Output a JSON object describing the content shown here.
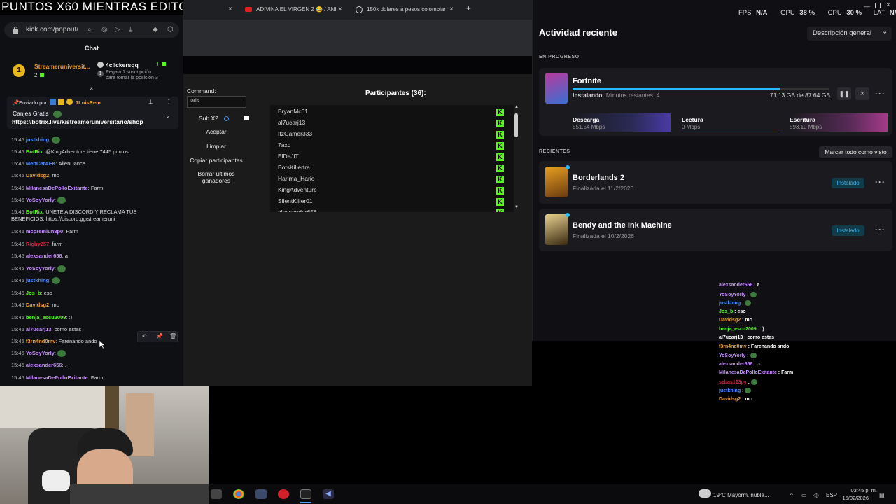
{
  "overlay_title": "PUNTOS X60 MIENTRAS EDITO",
  "chat_window": {
    "url": "kick.com/popout/",
    "header": "Chat",
    "leader_1": {
      "name": "Streameruniversit...",
      "count": "2"
    },
    "leader_2": {
      "name": "4clickersqq",
      "count": "1",
      "rank_badge": "1",
      "subtitle_line1": "Regala 1 suscripción",
      "subtitle_line2": "para tomar la posición 3"
    },
    "pinned": {
      "sent_by_label": "Enviado por",
      "sent_by_name": "1LuisRem",
      "title": "Canjes Gratis",
      "link": "https://botrix.live/k/streameruniversitario/shop"
    },
    "messages": [
      {
        "time": "15:45",
        "user": "justkhing",
        "text": "",
        "color": "#4f8cff",
        "emote": true
      },
      {
        "time": "15:45",
        "user": "BotRix",
        "text": "@KingAdventure tiene 7445 puntos.",
        "color": "#53fc18",
        "emote": false
      },
      {
        "time": "15:45",
        "user": "MenCerAFK",
        "text": "AlienDance",
        "color": "#4f8cff",
        "emote": false
      },
      {
        "time": "15:45",
        "user": "Davidsg2",
        "text": "mc",
        "color": "#f0a030",
        "emote": false
      },
      {
        "time": "15:45",
        "user": "MilanesaDePolloExitante",
        "text": "Farm",
        "color": "#c68dff",
        "emote": false
      },
      {
        "time": "15:45",
        "user": "YoSoyYorly",
        "text": "",
        "color": "#c68dff",
        "emote": true
      },
      {
        "time": "15:45",
        "user": "BotRix",
        "text": "UNETE A DISCORD Y RECLAMA TUS",
        "color": "#53fc18",
        "emote": false
      },
      {
        "time": "",
        "user": "",
        "text": "BENEFICIOS: https://discord.gg/streameruni",
        "color": "#ddd",
        "emote": false
      },
      {
        "time": "15:45",
        "user": "mcpremiun8p0",
        "text": "Farm",
        "color": "#c68dff",
        "emote": false
      },
      {
        "time": "15:45",
        "user": "Rigby257",
        "text": "farm",
        "color": "#e02040",
        "emote": false
      },
      {
        "time": "15:45",
        "user": "alexsander656",
        "text": "a",
        "color": "#c68dff",
        "emote": false
      },
      {
        "time": "15:45",
        "user": "YoSoyYorly",
        "text": "",
        "color": "#c68dff",
        "emote": true
      },
      {
        "time": "15:45",
        "user": "justkhing",
        "text": "",
        "color": "#4f8cff",
        "emote": true
      },
      {
        "time": "15:45",
        "user": "Jos_b",
        "text": "eso",
        "color": "#53fc18",
        "emote": false
      },
      {
        "time": "15:45",
        "user": "Davidsg2",
        "text": "mc",
        "color": "#f0a030",
        "emote": false
      },
      {
        "time": "15:45",
        "user": "benja_escu2009",
        "text": ":)",
        "color": "#53fc18",
        "emote": false
      },
      {
        "time": "15:45",
        "user": "al7ucarj13",
        "text": "como estas",
        "color": "#c68dff",
        "emote": false
      },
      {
        "time": "15:45",
        "user": "f3rn4nd0mv",
        "text": "Farenando ando",
        "color": "#f0a030",
        "emote": false
      },
      {
        "time": "15:45",
        "user": "YoSoyYorly",
        "text": "",
        "color": "#c68dff",
        "emote": true
      },
      {
        "time": "15:45",
        "user": "alexsander656",
        "text": ".-.",
        "color": "#c68dff",
        "emote": false
      },
      {
        "time": "15:45",
        "user": "MilanesaDePolloExitante",
        "text": "Farm",
        "color": "#c68dff",
        "emote": false
      }
    ]
  },
  "browser": {
    "tabs": [
      {
        "label": "ADIVINA EL VIRGEN 2 😂 / ANI"
      },
      {
        "label": "150k dolares a pesos colombiar"
      }
    ],
    "new_tab": "+",
    "close": "×"
  },
  "giveaway": {
    "command_label": "Command:",
    "command_value": "!aris",
    "sub_label": "Sub X2",
    "buttons": [
      "Aceptar",
      "Limpiar",
      "Copiar participantes",
      "Borrar ultimos ganadores"
    ],
    "participants_title": "Participantes (36):",
    "participants": [
      "BryanMc61",
      "al7ucarj13",
      "ItzGamer333",
      "7axq",
      "ElDeJiT",
      "BotsKillertra",
      "Harima_Hario",
      "KingAdventure",
      "SilentKiller01",
      "alexsander656"
    ]
  },
  "epic": {
    "title": "Actividad reciente",
    "filter": "Descripción general",
    "in_progress_label": "EN PROGRESO",
    "current": {
      "name": "Fortnite",
      "status": "Instalando",
      "remaining": "Minutos restantes: 4",
      "size": "71.13 GB de 87.64 GB",
      "progress": 0.81,
      "download_label": "Descarga",
      "download_value": "551.54 Mbps",
      "read_label": "Lectura",
      "read_value": "0 Mbps",
      "write_label": "Escritura",
      "write_value": "593.10 Mbps"
    },
    "recent_label": "RECIENTES",
    "mark_all": "Marcar todo como visto",
    "recent": [
      {
        "name": "Borderlands 2",
        "finished": "Finalizada el 11/2/2026",
        "badge": "Instalado"
      },
      {
        "name": "Bendy and the Ink Machine",
        "finished": "Finalizada el 10/2/2026",
        "badge": "Instalado"
      }
    ],
    "stats": {
      "fps_label": "FPS",
      "fps_value": "N/A",
      "gpu_label": "GPU",
      "gpu_value": "38 %",
      "cpu_label": "CPU",
      "cpu_value": "30 %",
      "lat_label": "LAT",
      "lat_value": "N/A"
    }
  },
  "overlay_chat": [
    {
      "user": "alexsander656",
      "text": "a",
      "color": "#c68dff"
    },
    {
      "user": "YoSoyYorly",
      "text": "",
      "color": "#c68dff"
    },
    {
      "user": "justkhing",
      "text": "",
      "color": "#4f8cff"
    },
    {
      "user": "Jos_b",
      "text": "eso",
      "color": "#53fc18"
    },
    {
      "user": "Davidsg2",
      "text": "mc",
      "color": "#f0a030"
    },
    {
      "user": "benja_escu2009",
      "text": ":)",
      "color": "#53fc18"
    },
    {
      "user": "al7ucarj13",
      "text": "como estas",
      "color": "#fff"
    },
    {
      "user": "f3rn4nd0mv",
      "text": "Farenando ando",
      "color": "#f0a030"
    },
    {
      "user": "YoSoyYorly",
      "text": "",
      "color": "#c68dff"
    },
    {
      "user": "alexsander656",
      "text": ".-.",
      "color": "#c68dff"
    },
    {
      "user": "MilanesaDePolloExitante",
      "text": "Farm",
      "color": "#c68dff"
    },
    {
      "user": "sebas123py",
      "text": "",
      "color": "#e02040"
    },
    {
      "user": "justkhing",
      "text": "",
      "color": "#4f8cff"
    },
    {
      "user": "Davidsg2",
      "text": "mc",
      "color": "#f0a030"
    }
  ],
  "taskbar": {
    "weather": "19°C  Mayorm. nubla...",
    "lang": "ESP",
    "time": "03:45 p. m.",
    "date": "15/02/2026"
  }
}
